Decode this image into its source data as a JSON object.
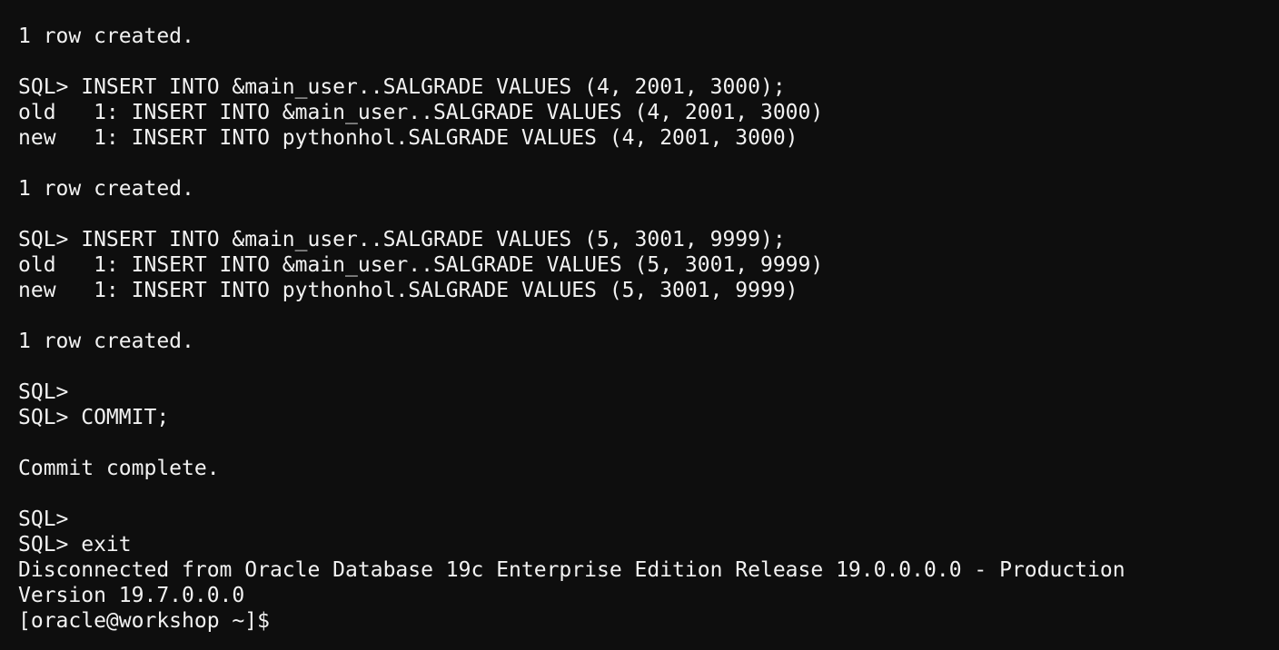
{
  "terminal": {
    "lines": [
      "1 row created.",
      "",
      "SQL> INSERT INTO &main_user..SALGRADE VALUES (4, 2001, 3000);",
      "old   1: INSERT INTO &main_user..SALGRADE VALUES (4, 2001, 3000)",
      "new   1: INSERT INTO pythonhol.SALGRADE VALUES (4, 2001, 3000)",
      "",
      "1 row created.",
      "",
      "SQL> INSERT INTO &main_user..SALGRADE VALUES (5, 3001, 9999);",
      "old   1: INSERT INTO &main_user..SALGRADE VALUES (5, 3001, 9999)",
      "new   1: INSERT INTO pythonhol.SALGRADE VALUES (5, 3001, 9999)",
      "",
      "1 row created.",
      "",
      "SQL>",
      "SQL> COMMIT;",
      "",
      "Commit complete.",
      "",
      "SQL>",
      "SQL> exit",
      "Disconnected from Oracle Database 19c Enterprise Edition Release 19.0.0.0.0 - Production",
      "Version 19.7.0.0.0",
      "[oracle@workshop ~]$"
    ]
  }
}
